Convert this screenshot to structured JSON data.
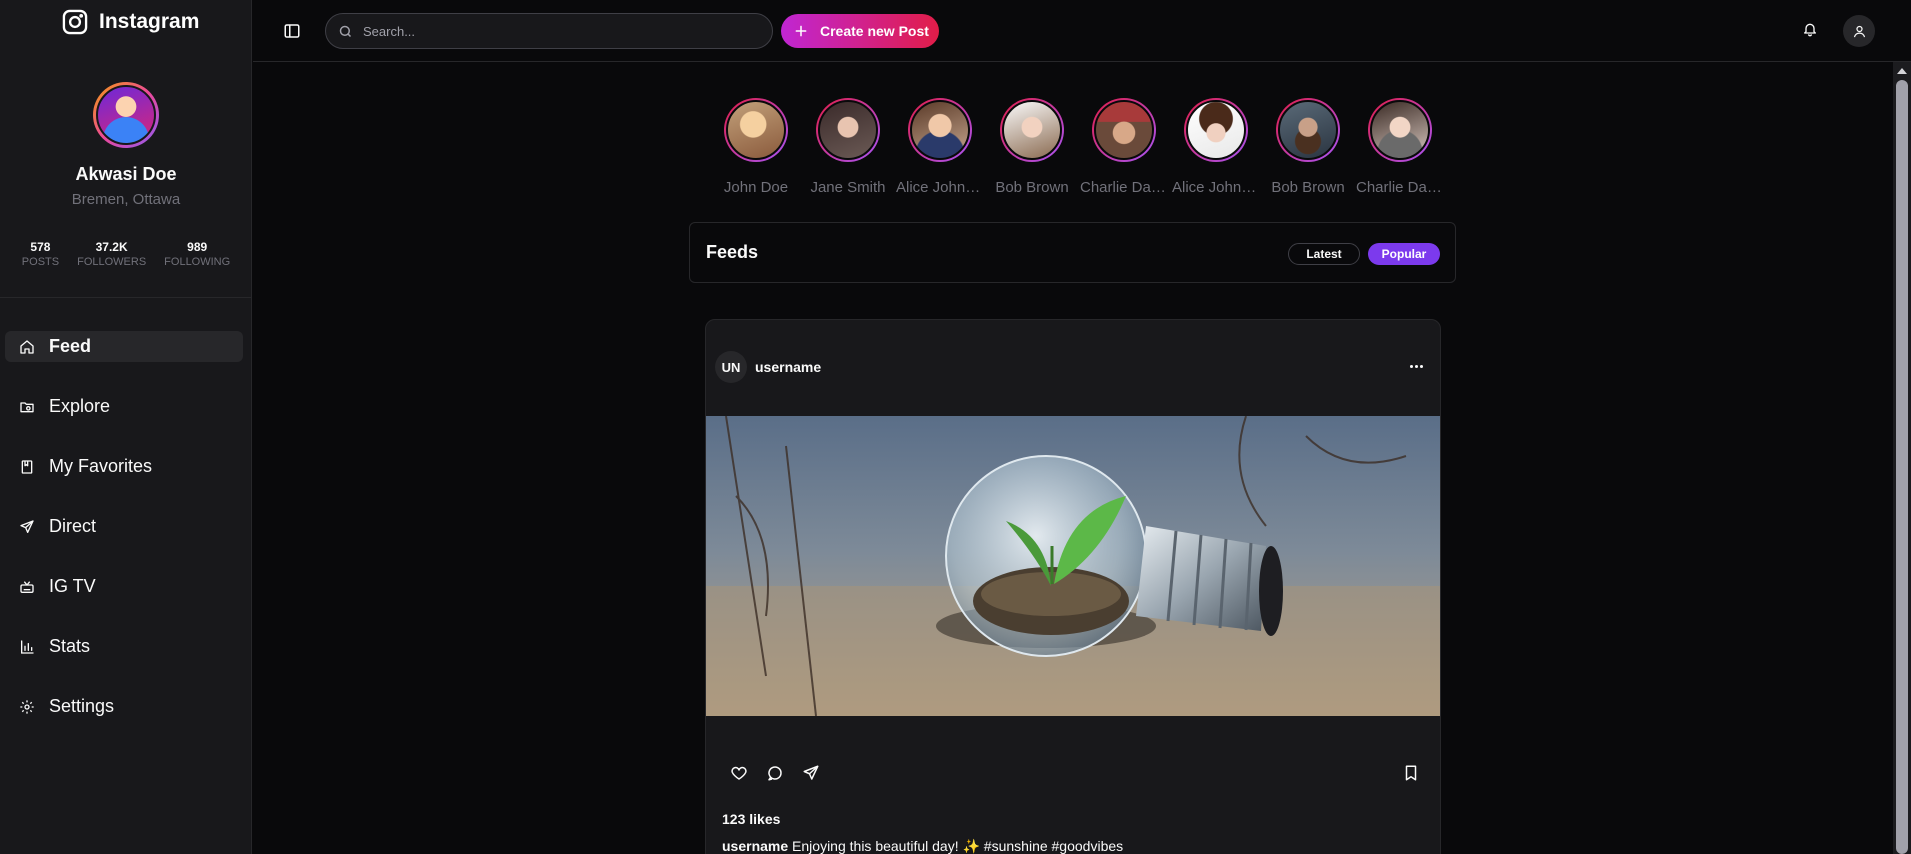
{
  "brand": {
    "name": "Instagram",
    "icon": "instagram-icon"
  },
  "profile": {
    "name": "Akwasi Doe",
    "location": "Bremen, Ottawa",
    "stats": [
      {
        "value": "578",
        "label": "POSTS"
      },
      {
        "value": "37.2K",
        "label": "FOLLOWERS"
      },
      {
        "value": "989",
        "label": "FOLLOWING"
      }
    ]
  },
  "nav": {
    "items": [
      {
        "label": "Feed",
        "icon": "home-icon",
        "active": true
      },
      {
        "label": "Explore",
        "icon": "explore-icon"
      },
      {
        "label": "My Favorites",
        "icon": "bookmark-icon"
      },
      {
        "label": "Direct",
        "icon": "send-icon"
      },
      {
        "label": "IG TV",
        "icon": "tv-icon"
      },
      {
        "label": "Stats",
        "icon": "chart-icon"
      },
      {
        "label": "Settings",
        "icon": "gear-icon"
      }
    ]
  },
  "topbar": {
    "search_placeholder": "Search...",
    "create_label": "Create new Post"
  },
  "stories": [
    {
      "name": "John Doe"
    },
    {
      "name": "Jane Smith"
    },
    {
      "name": "Alice Johnson"
    },
    {
      "name": "Bob Brown"
    },
    {
      "name": "Charlie Davis"
    },
    {
      "name": "Alice Johnson"
    },
    {
      "name": "Bob Brown"
    },
    {
      "name": "Charlie Davis"
    }
  ],
  "feeds": {
    "title": "Feeds",
    "tabs": [
      {
        "label": "Latest",
        "active": false
      },
      {
        "label": "Popular",
        "active": true
      }
    ]
  },
  "post": {
    "avatar_initials": "UN",
    "username": "username",
    "likes": "123 likes",
    "caption_user": "username",
    "caption_text": "Enjoying this beautiful day! ✨ #sunshine #goodvibes"
  },
  "colors": {
    "accent": "#7c3aed",
    "create_gradient_start": "#c026d3",
    "create_gradient_end": "#e11d48",
    "background": "#09090b",
    "surface": "#18181b"
  }
}
